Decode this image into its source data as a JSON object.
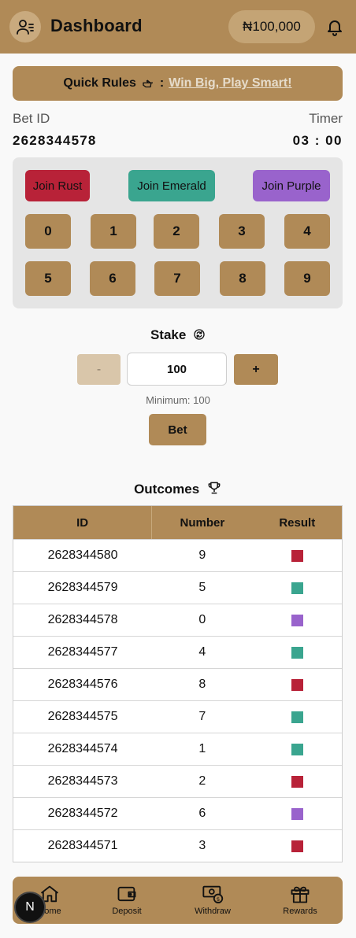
{
  "header": {
    "title": "Dashboard",
    "balance": "₦100,000"
  },
  "rules": {
    "label": "Quick Rules",
    "separator": ":",
    "link": "Win Big, Play Smart!"
  },
  "bet": {
    "id_label": "Bet ID",
    "id_value": "2628344578",
    "timer_label": "Timer",
    "timer_value": "03 : 00"
  },
  "join_buttons": {
    "rust": "Join Rust",
    "emerald": "Join Emerald",
    "purple": "Join Purple"
  },
  "numbers": [
    "0",
    "1",
    "2",
    "3",
    "4",
    "5",
    "6",
    "7",
    "8",
    "9"
  ],
  "stake": {
    "label": "Stake",
    "minus": "-",
    "value": "100",
    "plus": "+",
    "minimum": "Minimum: 100",
    "bet_button": "Bet"
  },
  "outcomes": {
    "label": "Outcomes",
    "headers": [
      "ID",
      "Number",
      "Result"
    ],
    "rows": [
      {
        "id": "2628344580",
        "number": "9",
        "result": "rust"
      },
      {
        "id": "2628344579",
        "number": "5",
        "result": "emerald"
      },
      {
        "id": "2628344578",
        "number": "0",
        "result": "purple"
      },
      {
        "id": "2628344577",
        "number": "4",
        "result": "emerald"
      },
      {
        "id": "2628344576",
        "number": "8",
        "result": "rust"
      },
      {
        "id": "2628344575",
        "number": "7",
        "result": "emerald"
      },
      {
        "id": "2628344574",
        "number": "1",
        "result": "emerald"
      },
      {
        "id": "2628344573",
        "number": "2",
        "result": "rust"
      },
      {
        "id": "2628344572",
        "number": "6",
        "result": "purple"
      },
      {
        "id": "2628344571",
        "number": "3",
        "result": "rust"
      }
    ]
  },
  "colors": {
    "brand": "#b08a57",
    "rust": "#b82238",
    "emerald": "#3aa58f",
    "purple": "#9963cc"
  },
  "nav": [
    {
      "label": "Home",
      "icon": "home-icon"
    },
    {
      "label": "Deposit",
      "icon": "wallet-icon"
    },
    {
      "label": "Withdraw",
      "icon": "cash-icon"
    },
    {
      "label": "Rewards",
      "icon": "gift-icon"
    }
  ],
  "badge": "N"
}
